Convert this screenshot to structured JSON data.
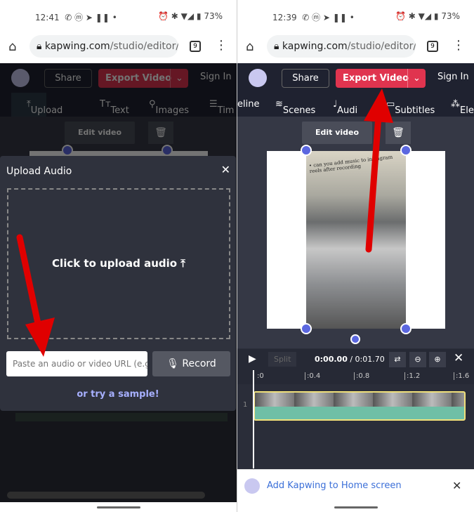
{
  "left": {
    "status": {
      "time": "12:41",
      "battery": "73%",
      "icons": "✆ ⓜ ➤ ❚❚ •",
      "right_icons": "⏰ ✱ ▼◢ ▮"
    },
    "browser": {
      "url_domain": "kapwing.com",
      "url_path": "/studio/editor/u",
      "tab_count": "9"
    },
    "header": {
      "share": "Share",
      "export": "Export Video",
      "sign_in": "Sign In"
    },
    "toolbar": [
      "Upload",
      "Text",
      "Images",
      "Tim"
    ],
    "canvas": {
      "edit_video": "Edit video"
    },
    "modal": {
      "title": "Upload Audio",
      "dropzone": "Click to upload audio",
      "url_placeholder": "Paste an audio or video URL (e.g.",
      "record": "Record",
      "sample": "or try a sample!"
    }
  },
  "right": {
    "status": {
      "time": "12:39",
      "battery": "73%",
      "icons": "✆ ⓜ ➤ ❚❚ •",
      "right_icons": "⏰ ✱ ▼◢ ▮"
    },
    "browser": {
      "url_domain": "kapwing.com",
      "url_path": "/studio/editor/l",
      "tab_count": "9"
    },
    "header": {
      "share": "Share",
      "export": "Export Video",
      "sign_in": "Sign In"
    },
    "toolbar": [
      "eline",
      "Scenes",
      "Audi",
      "Subtitles",
      "Ele"
    ],
    "canvas": {
      "edit_video": "Edit video",
      "video_text": "• can you add music to instagram reels after recording"
    },
    "timeline": {
      "split": "Split",
      "current": "0:00.00",
      "duration": "/ 0:01.70",
      "ticks": [
        ":0",
        ":0.4",
        ":0.8",
        ":1.2",
        ":1.6"
      ],
      "track_number": "1"
    },
    "banner": {
      "text": "Add Kapwing to Home screen"
    }
  },
  "colors": {
    "accent": "#e0344f",
    "handle": "#5b67e0",
    "arrow": "#e00000"
  }
}
